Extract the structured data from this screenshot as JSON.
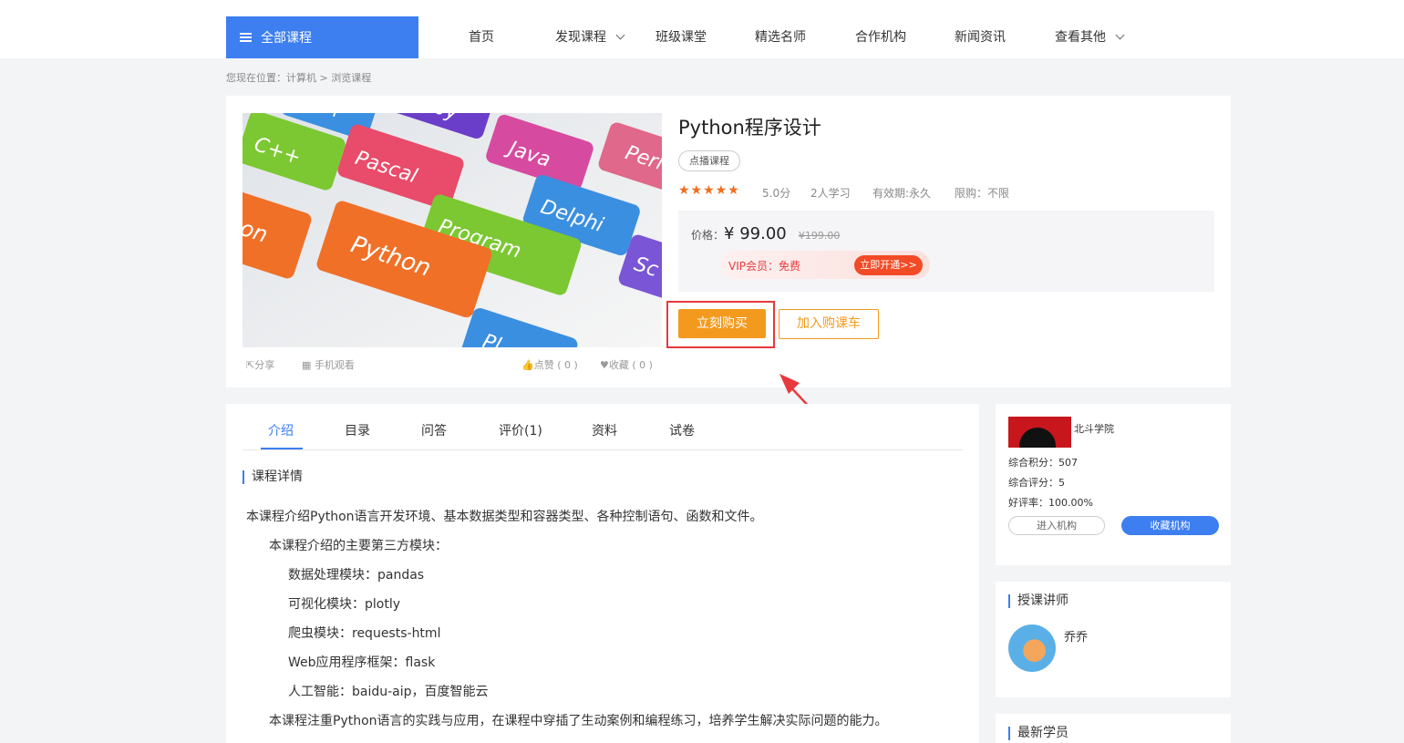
{
  "header": {
    "all_courses": "全部课程",
    "nav": [
      "首页",
      "发现课程",
      "班级课堂",
      "精选名师",
      "合作机构",
      "新闻资讯",
      "查看其他"
    ]
  },
  "breadcrumb": "您现在位置：计算机 >  浏览课程",
  "cover": {
    "keys": [
      "Ruby",
      "Java",
      "Perl",
      "C++",
      "Pascal",
      "Delphi",
      "C++",
      "Program",
      "Python",
      "ython",
      "Sc",
      "Pl"
    ]
  },
  "media_actions": {
    "share": "分享",
    "mobile": "手机观看",
    "like": "点赞 ( 0 )",
    "favorite": "收藏 ( 0 )"
  },
  "course": {
    "title": "Python程序设计",
    "tag": "点播课程",
    "rating_stars": 5,
    "stars_text": "★★★★★",
    "score": "5.0分",
    "learners": "2人学习",
    "validity": "有效期:永久",
    "limit": "限购：不限",
    "price_label": "价格：",
    "price": "¥ 99.00",
    "original_price": "¥199.00",
    "vip_text": "VIP会员：免费",
    "vip_button": "立即开通>>",
    "buy_button": "立刻购买",
    "cart_button": "加入购课车"
  },
  "tabs": [
    "介绍",
    "目录",
    "问答",
    "评价(1)",
    "资料",
    "试卷"
  ],
  "details": {
    "heading": "课程详情",
    "lines": [
      "本课程介绍Python语言开发环境、基本数据类型和容器类型、各种控制语句、函数和文件。",
      "本课程介绍的主要第三方模块：",
      "数据处理模块：pandas",
      "可视化模块：plotly",
      "爬虫模块：requests-html",
      "Web应用程序框架：flask",
      "人工智能：baidu-aip，百度智能云",
      "本课程注重Python语言的实践与应用，在课程中穿插了生动案例和编程练习，培养学生解决实际问题的能力。"
    ]
  },
  "institution": {
    "name": "北斗学院",
    "points": "综合积分：507",
    "rating": "综合评分：5",
    "good_rate": "好评率：100.00%",
    "enter": "进入机构",
    "favorite": "收藏机构"
  },
  "teacher": {
    "heading": "授课讲师",
    "name": "乔乔"
  },
  "students": {
    "heading": "最新学员"
  },
  "colors": {
    "primary": "#3d7ef0",
    "buy": "#f39a1e",
    "highlight": "#e8393d",
    "vip": "#f24b26"
  }
}
